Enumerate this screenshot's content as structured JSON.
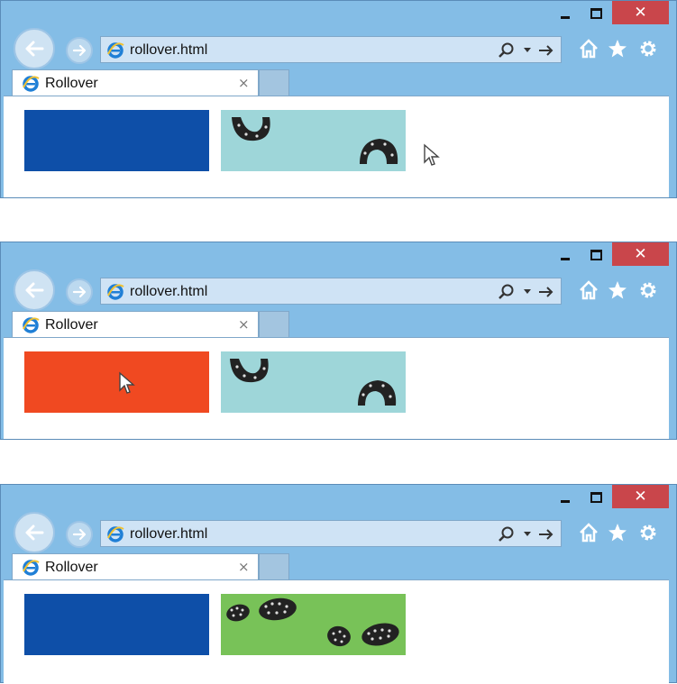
{
  "colors": {
    "chrome": "#84bde6",
    "close": "#c9464b",
    "link_blue": "#0e4fa8",
    "link_hover": "#f04921",
    "horseshoe_bg": "#9ed6d9",
    "footprint_bg": "#78c258"
  },
  "windows": [
    {
      "url": "rollover.html",
      "tab_title": "Rollover",
      "close_glyph": "✕",
      "tab_close_glyph": "×",
      "link_state": "normal",
      "image": "horseshoe",
      "cursor": "outside"
    },
    {
      "url": "rollover.html",
      "tab_title": "Rollover",
      "close_glyph": "✕",
      "tab_close_glyph": "×",
      "link_state": "hover",
      "image": "horseshoe",
      "cursor": "on-link"
    },
    {
      "url": "rollover.html",
      "tab_title": "Rollover",
      "close_glyph": "✕",
      "tab_close_glyph": "×",
      "link_state": "normal",
      "image": "footprints",
      "cursor": "none"
    }
  ],
  "icons": [
    "back-arrow-icon",
    "forward-arrow-icon",
    "ie-logo-icon",
    "search-icon",
    "dropdown-icon",
    "go-arrow-icon",
    "home-icon",
    "star-icon",
    "gear-icon",
    "horseshoe-icon",
    "footprint-icon",
    "cursor-icon"
  ]
}
